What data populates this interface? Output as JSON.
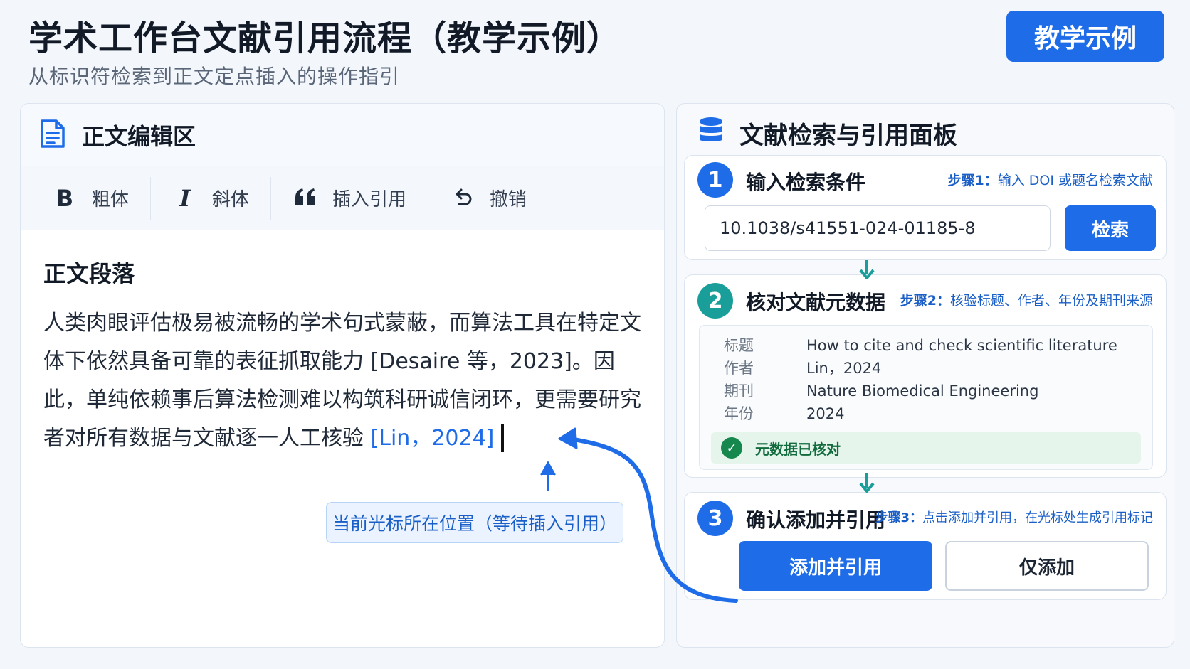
{
  "header": {
    "title": "学术工作台文献引用流程（教学示例）",
    "subtitle": "从标识符检索到正文定点插入的操作指引",
    "badge": "教学示例"
  },
  "editor_panel": {
    "title": "正文编辑区",
    "toolbar": {
      "bold_icon": "B",
      "bold": "粗体",
      "italic_icon": "I",
      "italic": "斜体",
      "quote_icon": "66",
      "cite": "插入引用",
      "undo_icon": "⟲",
      "undo": "撤销"
    },
    "paragraph_title": "正文段落",
    "paragraph_text": "人类肉眼评估极易被流畅的学术句式蒙蔽，而算法工具在特定文体下依然具备可靠的表征抓取能力 [Desaire 等，2023]。因此，单纯依赖事后算法检测难以构筑科研诚信闭环，更需要研究者对所有数据与文献逐一人工核验 ",
    "inserted_citation": "[Lin，2024]",
    "cursor_tip": "当前光标所在位置（等待插入引用）"
  },
  "citation_panel": {
    "title": "文献检索与引用面板",
    "step1": {
      "number": "1",
      "title": "输入检索条件",
      "hint_prefix": "步骤1：",
      "hint": "输入 DOI 或题名检索文献",
      "input_value": "10.1038/s41551-024-01185-8",
      "search_button": "检索"
    },
    "step2": {
      "number": "2",
      "title": "核对文献元数据",
      "hint_prefix": "步骤2：",
      "hint": "核验标题、作者、年份及期刊来源",
      "metadata": [
        {
          "key": "标题",
          "value": "How to cite and check scientific literature"
        },
        {
          "key": "作者",
          "value": "Lin，2024"
        },
        {
          "key": "期刊",
          "value": "Nature Biomedical Engineering"
        },
        {
          "key": "年份",
          "value": "2024"
        }
      ],
      "verified_label": "元数据已核对"
    },
    "step3": {
      "number": "3",
      "title": "确认添加并引用",
      "hint_prefix": "步骤3：",
      "hint": "点击添加并引用，在光标处生成引用标记",
      "add_cite_button": "添加并引用",
      "add_only_button": "仅添加"
    }
  },
  "colors": {
    "primary_blue": "#1e6ce8",
    "teal": "#1a9e9a",
    "success_green": "#16884d"
  }
}
